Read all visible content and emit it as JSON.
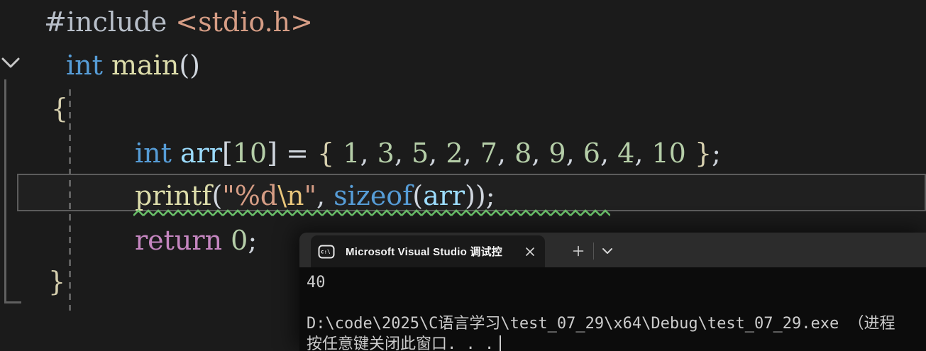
{
  "editor": {
    "palette": {
      "preproc": "#b8bfc9",
      "string": "#d69d85",
      "escape": "#e8c57b",
      "keyword": "#569cd6",
      "keyword_flow": "#c586c0",
      "function": "#dcdcaa",
      "variable": "#9cdcfe",
      "number": "#b5cea8",
      "punct": "#d0d6de",
      "brace": "#d6cfae"
    },
    "diagnostic_squiggle_color": "#6abf69",
    "background": "#1b1b1b",
    "lines": [
      {
        "tokens": [
          {
            "t": "#include ",
            "c": "preproc"
          },
          {
            "t": "<stdio.h>",
            "c": "string"
          }
        ]
      },
      {
        "tokens": [
          {
            "t": "int ",
            "c": "keyword"
          },
          {
            "t": "main",
            "c": "function"
          },
          {
            "t": "()",
            "c": "punct"
          }
        ]
      },
      {
        "tokens": [
          {
            "t": "{",
            "c": "brace"
          }
        ]
      },
      {
        "tokens": [
          {
            "t": "int ",
            "c": "keyword"
          },
          {
            "t": "arr",
            "c": "variable"
          },
          {
            "t": "[",
            "c": "punct"
          },
          {
            "t": "10",
            "c": "number"
          },
          {
            "t": "] ",
            "c": "punct"
          },
          {
            "t": "= ",
            "c": "punct"
          },
          {
            "t": "{ ",
            "c": "brace"
          },
          {
            "t": "1",
            "c": "number"
          },
          {
            "t": ", ",
            "c": "punct"
          },
          {
            "t": "3",
            "c": "number"
          },
          {
            "t": ", ",
            "c": "punct"
          },
          {
            "t": "5",
            "c": "number"
          },
          {
            "t": ", ",
            "c": "punct"
          },
          {
            "t": "2",
            "c": "number"
          },
          {
            "t": ", ",
            "c": "punct"
          },
          {
            "t": "7",
            "c": "number"
          },
          {
            "t": ", ",
            "c": "punct"
          },
          {
            "t": "8",
            "c": "number"
          },
          {
            "t": ", ",
            "c": "punct"
          },
          {
            "t": "9",
            "c": "number"
          },
          {
            "t": ", ",
            "c": "punct"
          },
          {
            "t": "6",
            "c": "number"
          },
          {
            "t": ", ",
            "c": "punct"
          },
          {
            "t": "4",
            "c": "number"
          },
          {
            "t": ", ",
            "c": "punct"
          },
          {
            "t": "10",
            "c": "number"
          },
          {
            "t": " }",
            "c": "brace"
          },
          {
            "t": ";",
            "c": "punct"
          }
        ]
      },
      {
        "tokens": [
          {
            "t": "printf",
            "c": "function"
          },
          {
            "t": "(",
            "c": "punct"
          },
          {
            "t": "\"%d",
            "c": "string"
          },
          {
            "t": "\\n",
            "c": "escape"
          },
          {
            "t": "\"",
            "c": "string"
          },
          {
            "t": ", ",
            "c": "punct"
          },
          {
            "t": "sizeof",
            "c": "keyword"
          },
          {
            "t": "(",
            "c": "punct"
          },
          {
            "t": "arr",
            "c": "variable"
          },
          {
            "t": "))",
            "c": "punct"
          },
          {
            "t": ";",
            "c": "punct"
          }
        ]
      },
      {
        "tokens": [
          {
            "t": "return ",
            "c": "keyword_flow"
          },
          {
            "t": "0",
            "c": "number"
          },
          {
            "t": ";",
            "c": "punct"
          }
        ]
      },
      {
        "tokens": [
          {
            "t": "}",
            "c": "brace"
          }
        ]
      }
    ]
  },
  "console": {
    "colors": {
      "tab_bar_bg": "#2c2c2c",
      "tab_bg": "#191919",
      "terminal_bg": "#0c0c0c",
      "terminal_text": "#cccccc"
    },
    "tab": {
      "title": "Microsoft Visual Studio 调试控"
    },
    "output": [
      "40",
      "",
      "D:\\code\\2025\\C语言学习\\test_07_29\\x64\\Debug\\test_07_29.exe （进程",
      "按任意键关闭此窗口. . ."
    ]
  },
  "icons": {
    "fold": "chevron-down",
    "console_tab": "command-prompt",
    "tab_close": "x-close",
    "new_tab": "plus",
    "tab_dropdown": "chevron-down"
  }
}
